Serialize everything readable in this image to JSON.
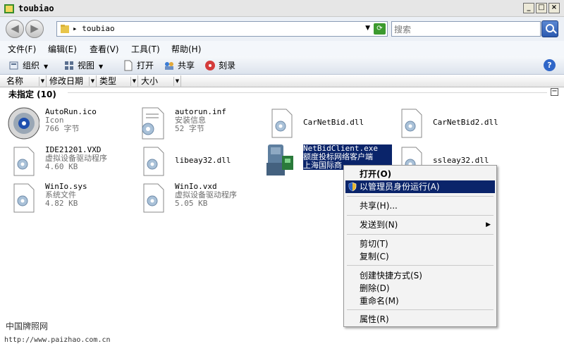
{
  "window": {
    "title": "toubiao",
    "buttons": [
      "_",
      "□",
      "×"
    ]
  },
  "nav": {
    "back": "◀",
    "forward": "▶",
    "address": "toubiao",
    "address_prefix": "▸",
    "search_placeholder": "搜索"
  },
  "menubar": {
    "items": [
      "文件(F)",
      "编辑(E)",
      "查看(V)",
      "工具(T)",
      "帮助(H)"
    ]
  },
  "toolbar": {
    "organize": "组织",
    "views": "视图",
    "open": "打开",
    "share": "共享",
    "burn": "刻录"
  },
  "columns": [
    "名称",
    "修改日期",
    "类型",
    "大小"
  ],
  "group": {
    "title": "未指定 (10)",
    "collapse": "−"
  },
  "files": [
    {
      "name": "AutoRun.ico",
      "type": "Icon",
      "size": "766 字节",
      "icon": "cd-icon"
    },
    {
      "name": "autorun.inf",
      "type": "安装信息",
      "size": "52 字节",
      "icon": "setup-file-icon"
    },
    {
      "name": "CarNetBid.dll",
      "icon": "dll-file-icon"
    },
    {
      "name": "CarNetBid2.dll",
      "icon": "dll-file-icon"
    },
    {
      "name": "IDE21201.VXD",
      "type": "虚拟设备驱动程序",
      "size": "4.60 KB",
      "icon": "dll-file-icon"
    },
    {
      "name": "libeay32.dll",
      "icon": "dll-file-icon"
    },
    {
      "name": "NetBidClient.exe",
      "type": "额度投标网络客户端",
      "size": "上海国际商",
      "icon": "app-icon",
      "selected": true
    },
    {
      "name": "ssleay32.dll",
      "icon": "dll-file-icon"
    },
    {
      "name": "WinIo.sys",
      "type": "系统文件",
      "size": "4.82 KB",
      "icon": "dll-file-icon"
    },
    {
      "name": "WinIo.vxd",
      "type": "虚拟设备驱动程序",
      "size": "5.05 KB",
      "icon": "dll-file-icon"
    }
  ],
  "context_menu": {
    "open": "打开(O)",
    "run_as_admin": "以管理员身份运行(A)",
    "share": "共享(H)...",
    "send_to": "发送到(N)",
    "cut": "剪切(T)",
    "copy": "复制(C)",
    "create_shortcut": "创建快捷方式(S)",
    "delete": "删除(D)",
    "rename": "重命名(M)",
    "properties": "属性(R)",
    "submenu_arrow": "▶"
  },
  "watermark": {
    "line1": "中国牌照网",
    "line2": "http://www.paizhao.com.cn"
  },
  "colors": {
    "selection": "#0a246a",
    "accent": "#2c5bb0"
  }
}
